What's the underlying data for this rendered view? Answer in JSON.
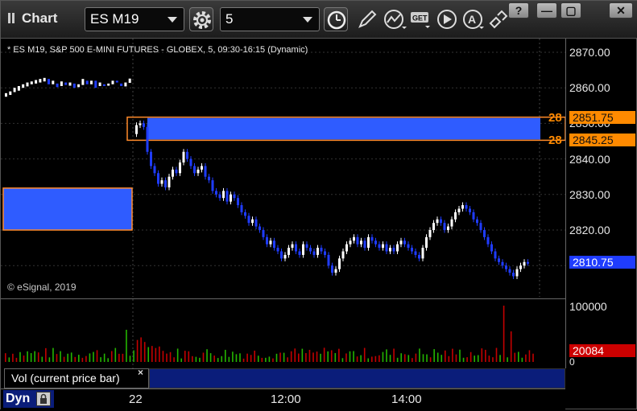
{
  "window": {
    "title": "Chart",
    "symbol": "ES M19",
    "interval": "5",
    "controls": [
      "?",
      "—",
      "▢",
      "✕"
    ]
  },
  "chart": {
    "description": "* ES M19, S&P 500 E-MINI FUTURES - GLOBEX, 5, 09:30-16:15 (Dynamic)",
    "copyright": "© eSignal, 2019",
    "price_labels": [
      "2870.00",
      "2860.00",
      "2850.00",
      "2840.00",
      "2830.00",
      "2820.00"
    ],
    "last_price": "2810.75",
    "zone_upper_price": "2851.75",
    "zone_lower_price": "2845.25",
    "zone_upper_cut": "28",
    "zone_lower_cut": "28",
    "colors": {
      "up": "#ffffff",
      "down": "#1f3cff",
      "zone": "#2f5cff",
      "zone_border": "#ff8a2a",
      "price_tag": "#ff8a00"
    }
  },
  "volume": {
    "legend": "Vol (current price bar)",
    "close_label": "×",
    "top_label": "100000",
    "last_value": "20084",
    "zero_label": "0",
    "colors": {
      "up": "#24b500",
      "down": "#c40000",
      "last_tag": "#cc0000"
    }
  },
  "xaxis": {
    "labels": [
      "22",
      "12:00",
      "14:00"
    ]
  },
  "statusbar": {
    "mode": "Dyn"
  },
  "icons": [
    "chart-bars-icon",
    "gear-icon",
    "clock-icon",
    "pencil-icon",
    "indicator-icon",
    "get-icon",
    "play-icon",
    "alert-icon",
    "link-icon"
  ]
}
